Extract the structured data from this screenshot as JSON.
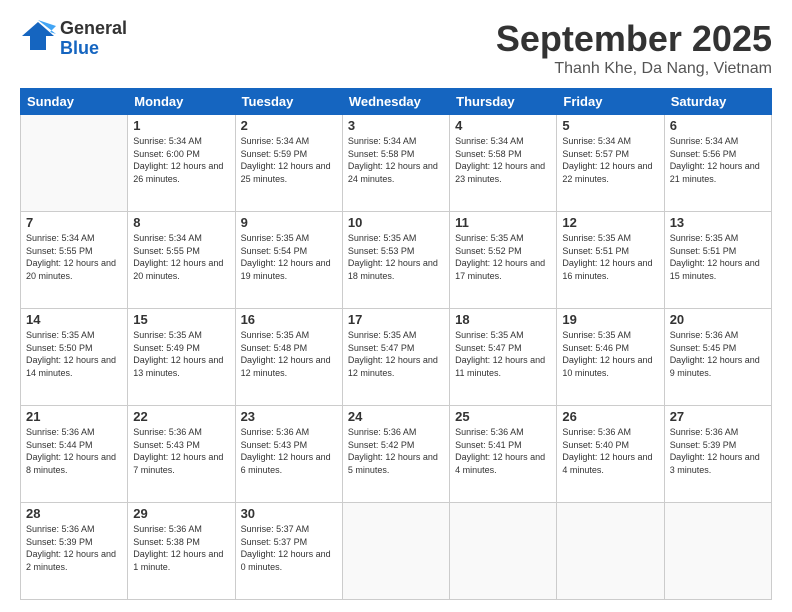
{
  "header": {
    "logo": {
      "general": "General",
      "blue": "Blue"
    },
    "month_year": "September 2025",
    "location": "Thanh Khe, Da Nang, Vietnam"
  },
  "days_of_week": [
    "Sunday",
    "Monday",
    "Tuesday",
    "Wednesday",
    "Thursday",
    "Friday",
    "Saturday"
  ],
  "weeks": [
    [
      {
        "day": "",
        "sunrise": "",
        "sunset": "",
        "daylight": ""
      },
      {
        "day": "1",
        "sunrise": "Sunrise: 5:34 AM",
        "sunset": "Sunset: 6:00 PM",
        "daylight": "Daylight: 12 hours and 26 minutes."
      },
      {
        "day": "2",
        "sunrise": "Sunrise: 5:34 AM",
        "sunset": "Sunset: 5:59 PM",
        "daylight": "Daylight: 12 hours and 25 minutes."
      },
      {
        "day": "3",
        "sunrise": "Sunrise: 5:34 AM",
        "sunset": "Sunset: 5:58 PM",
        "daylight": "Daylight: 12 hours and 24 minutes."
      },
      {
        "day": "4",
        "sunrise": "Sunrise: 5:34 AM",
        "sunset": "Sunset: 5:58 PM",
        "daylight": "Daylight: 12 hours and 23 minutes."
      },
      {
        "day": "5",
        "sunrise": "Sunrise: 5:34 AM",
        "sunset": "Sunset: 5:57 PM",
        "daylight": "Daylight: 12 hours and 22 minutes."
      },
      {
        "day": "6",
        "sunrise": "Sunrise: 5:34 AM",
        "sunset": "Sunset: 5:56 PM",
        "daylight": "Daylight: 12 hours and 21 minutes."
      }
    ],
    [
      {
        "day": "7",
        "sunrise": "Sunrise: 5:34 AM",
        "sunset": "Sunset: 5:55 PM",
        "daylight": "Daylight: 12 hours and 20 minutes."
      },
      {
        "day": "8",
        "sunrise": "Sunrise: 5:34 AM",
        "sunset": "Sunset: 5:55 PM",
        "daylight": "Daylight: 12 hours and 20 minutes."
      },
      {
        "day": "9",
        "sunrise": "Sunrise: 5:35 AM",
        "sunset": "Sunset: 5:54 PM",
        "daylight": "Daylight: 12 hours and 19 minutes."
      },
      {
        "day": "10",
        "sunrise": "Sunrise: 5:35 AM",
        "sunset": "Sunset: 5:53 PM",
        "daylight": "Daylight: 12 hours and 18 minutes."
      },
      {
        "day": "11",
        "sunrise": "Sunrise: 5:35 AM",
        "sunset": "Sunset: 5:52 PM",
        "daylight": "Daylight: 12 hours and 17 minutes."
      },
      {
        "day": "12",
        "sunrise": "Sunrise: 5:35 AM",
        "sunset": "Sunset: 5:51 PM",
        "daylight": "Daylight: 12 hours and 16 minutes."
      },
      {
        "day": "13",
        "sunrise": "Sunrise: 5:35 AM",
        "sunset": "Sunset: 5:51 PM",
        "daylight": "Daylight: 12 hours and 15 minutes."
      }
    ],
    [
      {
        "day": "14",
        "sunrise": "Sunrise: 5:35 AM",
        "sunset": "Sunset: 5:50 PM",
        "daylight": "Daylight: 12 hours and 14 minutes."
      },
      {
        "day": "15",
        "sunrise": "Sunrise: 5:35 AM",
        "sunset": "Sunset: 5:49 PM",
        "daylight": "Daylight: 12 hours and 13 minutes."
      },
      {
        "day": "16",
        "sunrise": "Sunrise: 5:35 AM",
        "sunset": "Sunset: 5:48 PM",
        "daylight": "Daylight: 12 hours and 12 minutes."
      },
      {
        "day": "17",
        "sunrise": "Sunrise: 5:35 AM",
        "sunset": "Sunset: 5:47 PM",
        "daylight": "Daylight: 12 hours and 12 minutes."
      },
      {
        "day": "18",
        "sunrise": "Sunrise: 5:35 AM",
        "sunset": "Sunset: 5:47 PM",
        "daylight": "Daylight: 12 hours and 11 minutes."
      },
      {
        "day": "19",
        "sunrise": "Sunrise: 5:35 AM",
        "sunset": "Sunset: 5:46 PM",
        "daylight": "Daylight: 12 hours and 10 minutes."
      },
      {
        "day": "20",
        "sunrise": "Sunrise: 5:36 AM",
        "sunset": "Sunset: 5:45 PM",
        "daylight": "Daylight: 12 hours and 9 minutes."
      }
    ],
    [
      {
        "day": "21",
        "sunrise": "Sunrise: 5:36 AM",
        "sunset": "Sunset: 5:44 PM",
        "daylight": "Daylight: 12 hours and 8 minutes."
      },
      {
        "day": "22",
        "sunrise": "Sunrise: 5:36 AM",
        "sunset": "Sunset: 5:43 PM",
        "daylight": "Daylight: 12 hours and 7 minutes."
      },
      {
        "day": "23",
        "sunrise": "Sunrise: 5:36 AM",
        "sunset": "Sunset: 5:43 PM",
        "daylight": "Daylight: 12 hours and 6 minutes."
      },
      {
        "day": "24",
        "sunrise": "Sunrise: 5:36 AM",
        "sunset": "Sunset: 5:42 PM",
        "daylight": "Daylight: 12 hours and 5 minutes."
      },
      {
        "day": "25",
        "sunrise": "Sunrise: 5:36 AM",
        "sunset": "Sunset: 5:41 PM",
        "daylight": "Daylight: 12 hours and 4 minutes."
      },
      {
        "day": "26",
        "sunrise": "Sunrise: 5:36 AM",
        "sunset": "Sunset: 5:40 PM",
        "daylight": "Daylight: 12 hours and 4 minutes."
      },
      {
        "day": "27",
        "sunrise": "Sunrise: 5:36 AM",
        "sunset": "Sunset: 5:39 PM",
        "daylight": "Daylight: 12 hours and 3 minutes."
      }
    ],
    [
      {
        "day": "28",
        "sunrise": "Sunrise: 5:36 AM",
        "sunset": "Sunset: 5:39 PM",
        "daylight": "Daylight: 12 hours and 2 minutes."
      },
      {
        "day": "29",
        "sunrise": "Sunrise: 5:36 AM",
        "sunset": "Sunset: 5:38 PM",
        "daylight": "Daylight: 12 hours and 1 minute."
      },
      {
        "day": "30",
        "sunrise": "Sunrise: 5:37 AM",
        "sunset": "Sunset: 5:37 PM",
        "daylight": "Daylight: 12 hours and 0 minutes."
      },
      {
        "day": "",
        "sunrise": "",
        "sunset": "",
        "daylight": ""
      },
      {
        "day": "",
        "sunrise": "",
        "sunset": "",
        "daylight": ""
      },
      {
        "day": "",
        "sunrise": "",
        "sunset": "",
        "daylight": ""
      },
      {
        "day": "",
        "sunrise": "",
        "sunset": "",
        "daylight": ""
      }
    ]
  ]
}
